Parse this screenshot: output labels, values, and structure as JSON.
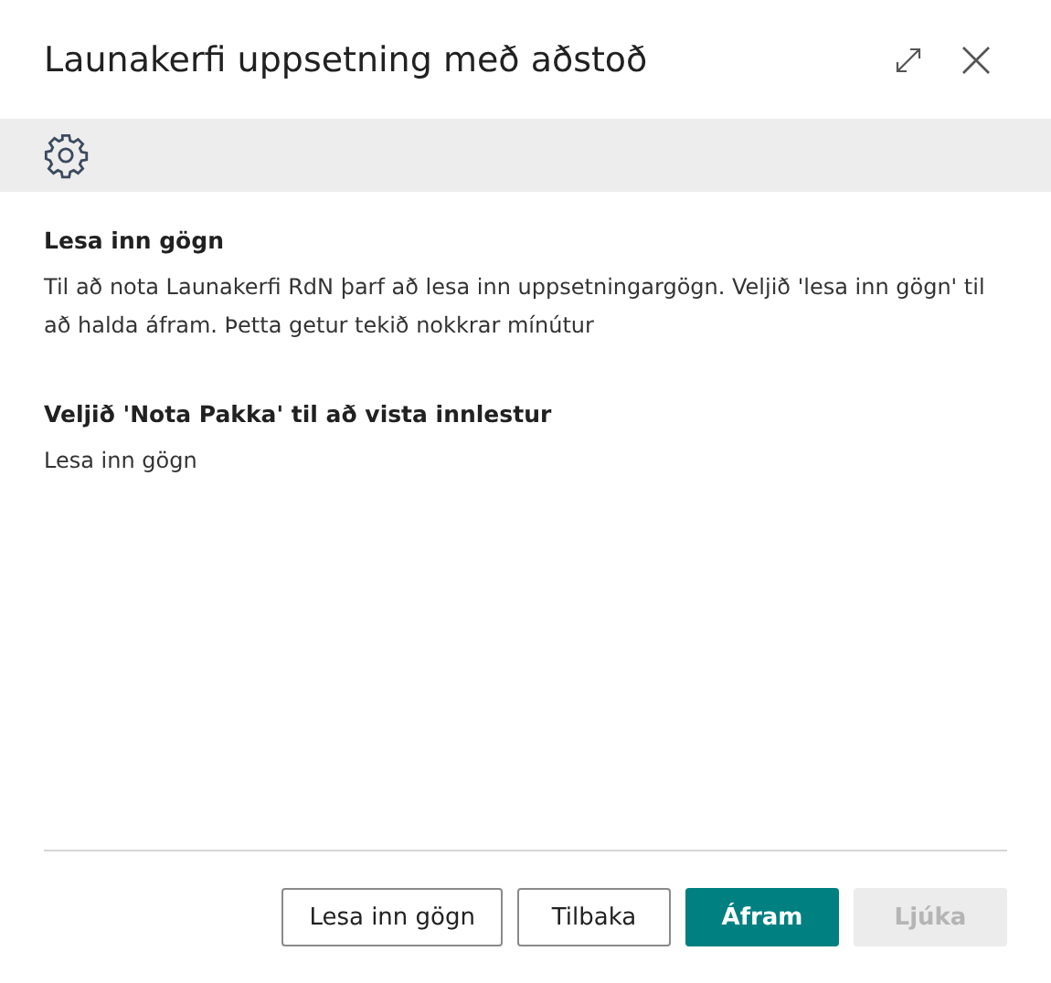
{
  "window": {
    "title": "Launakerfi uppsetning með aðstoð"
  },
  "sections": [
    {
      "heading": "Lesa inn gögn",
      "text": "Til að nota Launakerfi RdN þarf að lesa inn uppsetningargögn. Veljið 'lesa inn gögn' til að halda áfram. Þetta getur tekið nokkrar mínútur"
    },
    {
      "heading": "Veljið 'Nota Pakka' til að vista innlestur",
      "text": "Lesa inn gögn"
    }
  ],
  "buttons": [
    {
      "label": "Lesa inn gögn",
      "kind": "default",
      "disabled": false
    },
    {
      "label": "Tilbaka",
      "kind": "default",
      "disabled": false
    },
    {
      "label": "Áfram",
      "kind": "primary",
      "disabled": false
    },
    {
      "label": "Ljúka",
      "kind": "default",
      "disabled": true
    }
  ]
}
